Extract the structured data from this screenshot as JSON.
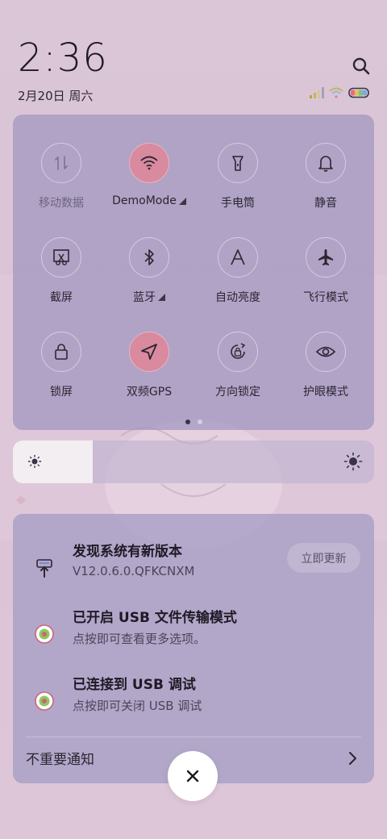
{
  "status": {
    "time": "2:36",
    "date": "2月20日 周六",
    "search_icon": "search-icon",
    "signal_icon": "signal-icon",
    "wifi_icon": "wifi-icon",
    "battery_icon": "battery-icon"
  },
  "quick_settings": {
    "tiles": [
      {
        "label": "移动数据",
        "icon": "mobile-data-icon",
        "active": false,
        "dim": true
      },
      {
        "label": "DemoMode",
        "icon": "wifi-icon",
        "active": true,
        "more": true
      },
      {
        "label": "手电筒",
        "icon": "flashlight-icon",
        "active": false
      },
      {
        "label": "静音",
        "icon": "bell-icon",
        "active": false
      },
      {
        "label": "截屏",
        "icon": "screenshot-icon",
        "active": false
      },
      {
        "label": "蓝牙",
        "icon": "bluetooth-icon",
        "active": false,
        "more": true
      },
      {
        "label": "自动亮度",
        "icon": "auto-brightness-icon",
        "active": false
      },
      {
        "label": "飞行模式",
        "icon": "airplane-icon",
        "active": false
      },
      {
        "label": "锁屏",
        "icon": "lock-icon",
        "active": false
      },
      {
        "label": "双频GPS",
        "icon": "location-arrow-icon",
        "active": true
      },
      {
        "label": "方向锁定",
        "icon": "rotation-lock-icon",
        "active": false
      },
      {
        "label": "护眼模式",
        "icon": "eye-icon",
        "active": false
      }
    ],
    "page_count": 2,
    "current_page": 1
  },
  "brightness": {
    "level": 0.22,
    "low_icon": "sun-small-icon",
    "high_icon": "sun-large-icon"
  },
  "notifications": [
    {
      "title": "发现系统有新版本",
      "subtitle": "V12.0.6.0.QFKCNXM",
      "icon": "system-update-icon",
      "action": "立即更新"
    },
    {
      "title": "已开启 USB 文件传输模式",
      "subtitle": "点按即可查看更多选项。",
      "icon": "android-debug-icon"
    },
    {
      "title": "已连接到 USB 调试",
      "subtitle": "点按即可关闭 USB 调试",
      "icon": "android-debug-icon"
    }
  ],
  "unimportant_label": "不重要通知",
  "close_icon": "close-icon"
}
